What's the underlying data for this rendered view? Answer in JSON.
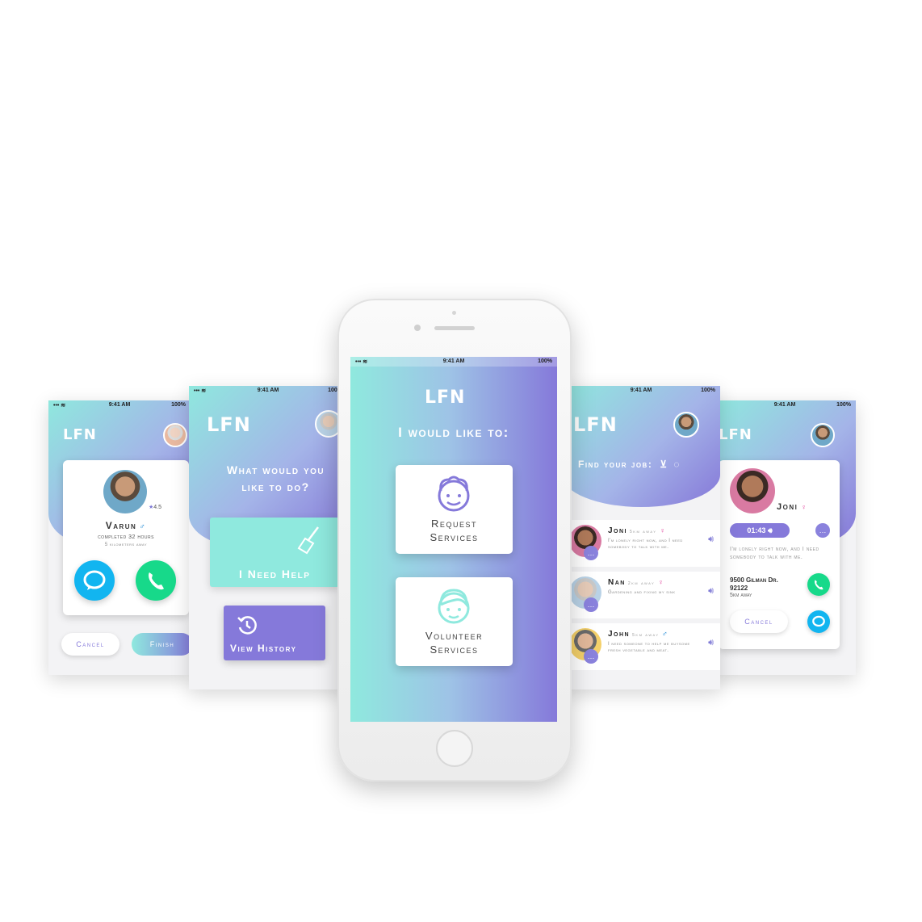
{
  "status": {
    "time": "9:41 AM",
    "battery": "100%",
    "signal": "••• ≋"
  },
  "app": {
    "logo": "LFN"
  },
  "screen1": {
    "name": "Varun",
    "rating": "4.5",
    "completed": "completed 32 hours",
    "distance": "5 kilometers away",
    "cancel": "Cancel",
    "finish": "Finish"
  },
  "screen2": {
    "question_line1": "What would you",
    "question_line2": "like to do?",
    "need_help": "I Need Help",
    "view_history": "View History"
  },
  "main": {
    "title": "I would like to:",
    "request_line1": "Request",
    "request_line2": "Services",
    "volunteer_line1": "Volunteer",
    "volunteer_line2": "Services"
  },
  "screen4": {
    "title": "Find your job:",
    "jobs": [
      {
        "name": "Joni",
        "distance": "5km away",
        "desc": "I'm lonely right now, and I need somebody to talk with me."
      },
      {
        "name": "Nan",
        "distance": "2km away",
        "desc": "Gardening and fixing my sink"
      },
      {
        "name": "John",
        "distance": "5km away",
        "desc": "I need someone to help me buysome fresh vegetable and meat."
      }
    ]
  },
  "screen5": {
    "name": "Joni",
    "timer": "01:43",
    "message": "I'm lonely right now, and I need somebody to talk with me.",
    "address_line1": "9500 Gilman Dr.",
    "address_line2": "92122",
    "distance": "5km away",
    "cancel": "Cancel"
  },
  "colors": {
    "teal": "#8fe9de",
    "purple": "#8579da",
    "call_green": "#17d98a",
    "chat_blue": "#12b5f0"
  }
}
